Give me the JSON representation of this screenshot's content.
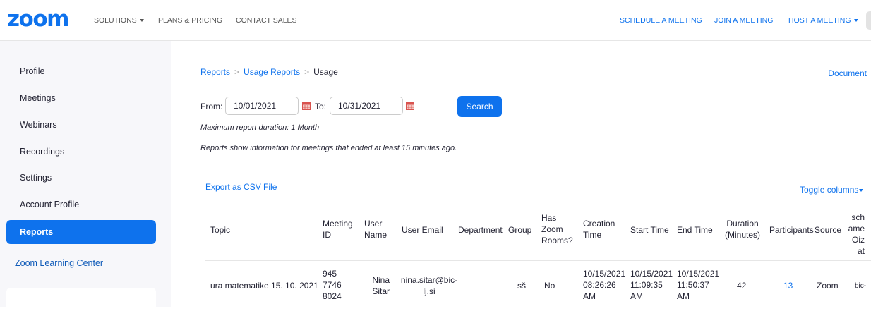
{
  "nav": {
    "logo": "zoom",
    "solutions": "SOLUTIONS",
    "plans": "PLANS & PRICING",
    "contact": "CONTACT SALES",
    "schedule": "SCHEDULE A MEETING",
    "join": "JOIN A MEETING",
    "host": "HOST A MEETING"
  },
  "sidebar": {
    "items": [
      {
        "label": "Profile"
      },
      {
        "label": "Meetings"
      },
      {
        "label": "Webinars"
      },
      {
        "label": "Recordings"
      },
      {
        "label": "Settings"
      },
      {
        "label": "Account Profile"
      },
      {
        "label": "Reports",
        "active": true
      }
    ],
    "learning_center": "Zoom Learning Center"
  },
  "breadcrumb": {
    "items": [
      "Reports",
      "Usage Reports",
      "Usage"
    ],
    "separator": ">"
  },
  "document_link": "Document",
  "filter": {
    "from_label": "From:",
    "from_value": "10/01/2021",
    "to_label": "To:",
    "to_value": "10/31/2021",
    "search_label": "Search",
    "max_note": "Maximum report duration: 1 Month",
    "info_note": "Reports show information for meetings that ended at least 15 minutes ago."
  },
  "actions": {
    "export": "Export as CSV File",
    "toggle_columns": "Toggle columns"
  },
  "table": {
    "headers": {
      "topic": "Topic",
      "meeting_id": "Meeting ID",
      "user_name": "User Name",
      "user_email": "User Email",
      "department": "Department",
      "group": "Group",
      "has_zoom_rooms": "Has Zoom Rooms?",
      "creation_time": "Creation Time",
      "start_time": "Start Time",
      "end_time": "End Time",
      "duration": "Duration (Minutes)",
      "participants": "Participants",
      "source": "Source",
      "schema_org": "schameOizat"
    },
    "rows": [
      {
        "topic": "ura matematike 15. 10. 2021",
        "meeting_id": [
          "945",
          "7746",
          "8024"
        ],
        "user_name": [
          "Nina",
          "Sitar"
        ],
        "user_email": [
          "nina.sitar@bic-",
          "lj.si"
        ],
        "department": "",
        "group": "sš",
        "has_zoom_rooms": "No",
        "creation_time": [
          "10/15/2021",
          "08:26:26",
          "AM"
        ],
        "start_time": [
          "10/15/2021",
          "11:09:35",
          "AM"
        ],
        "end_time": [
          "10/15/2021",
          "11:50:37",
          "AM"
        ],
        "duration": "42",
        "participants": "13",
        "source": "Zoom",
        "schema_org": "bic-"
      }
    ]
  },
  "colors": {
    "accent": "#0e72ed",
    "sidebar_bg": "#f7f7fa",
    "text": "#232333"
  },
  "icons": [
    "calendar-icon",
    "caret-down-icon"
  ]
}
